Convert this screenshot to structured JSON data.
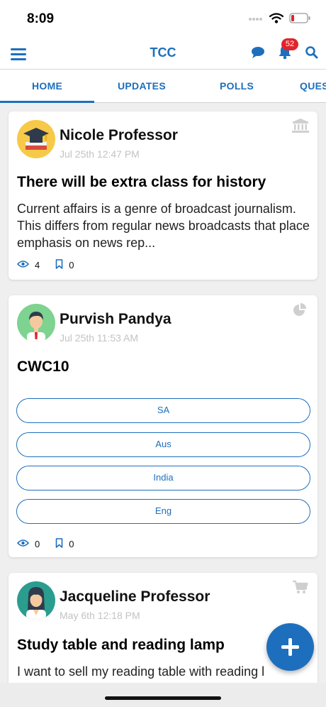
{
  "status_bar": {
    "time": "8:09"
  },
  "header": {
    "title": "TCC",
    "notification_count": "52"
  },
  "tabs": [
    {
      "label": "HOME",
      "active": true
    },
    {
      "label": "UPDATES",
      "active": false
    },
    {
      "label": "POLLS",
      "active": false
    },
    {
      "label": "QUES",
      "active": false
    }
  ],
  "posts": [
    {
      "author": "Nicole Professor",
      "time": "Jul 25th 12:47 PM",
      "type_icon": "bank-icon",
      "title": "There will be extra class for history",
      "body": "Current affairs is a genre of broadcast journalism. This differs from regular news broadcasts that place emphasis on news rep...",
      "views": "4",
      "bookmarks": "0"
    },
    {
      "author": "Purvish Pandya",
      "time": "Jul 25th 11:53 AM",
      "type_icon": "pie-chart-icon",
      "title": "CWC10",
      "options": [
        "SA",
        "Aus",
        "India",
        "Eng"
      ],
      "views": "0",
      "bookmarks": "0"
    },
    {
      "author": "Jacqueline Professor",
      "time": "May 6th 12:18 PM",
      "type_icon": "cart-icon",
      "title": "Study table and reading lamp",
      "body": "I want to sell my reading table with reading l"
    }
  ],
  "colors": {
    "accent": "#1d6fbd",
    "badge": "#e0242b",
    "background": "#efefef"
  }
}
